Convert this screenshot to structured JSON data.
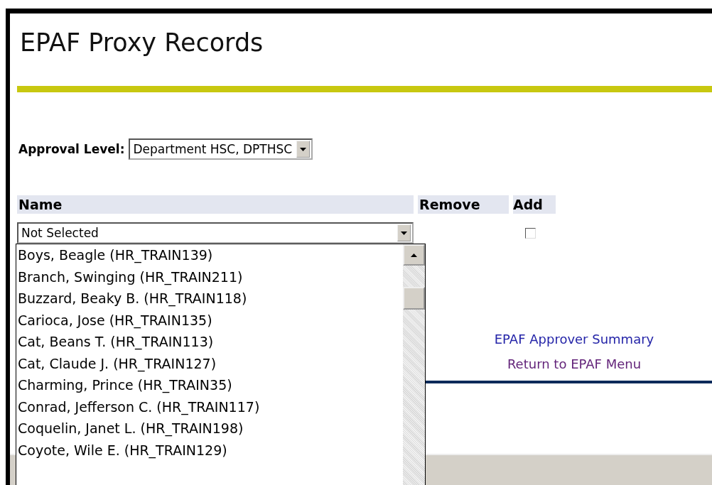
{
  "page": {
    "title": "EPAF Proxy Records"
  },
  "approval_level": {
    "label": "Approval Level:",
    "value": "Department HSC, DPTHSC"
  },
  "table": {
    "columns": [
      "Name",
      "Remove",
      "Add"
    ],
    "row": {
      "name_value": "Not Selected",
      "add_checked": false
    }
  },
  "name_dropdown": {
    "options": [
      {
        "label": "Boys, Beagle (HR_TRAIN139)"
      },
      {
        "label": "Branch, Swinging (HR_TRAIN211)"
      },
      {
        "label": "Buzzard, Beaky B. (HR_TRAIN118)"
      },
      {
        "label": "Carioca, Jose (HR_TRAIN135)"
      },
      {
        "label": "Cat, Beans T. (HR_TRAIN113)"
      },
      {
        "label": "Cat, Claude J. (HR_TRAIN127)"
      },
      {
        "label": "Charming, Prince (HR_TRAIN35)"
      },
      {
        "label": "Conrad, Jefferson C. (HR_TRAIN117)"
      },
      {
        "label": "Coquelin, Janet L. (HR_TRAIN198)"
      },
      {
        "label": "Coyote, Wile E. (HR_TRAIN129)"
      }
    ]
  },
  "links": [
    {
      "label": "EPAF Approver Summary",
      "visited": false
    },
    {
      "label": "Return to EPAF Menu",
      "visited": true
    }
  ]
}
